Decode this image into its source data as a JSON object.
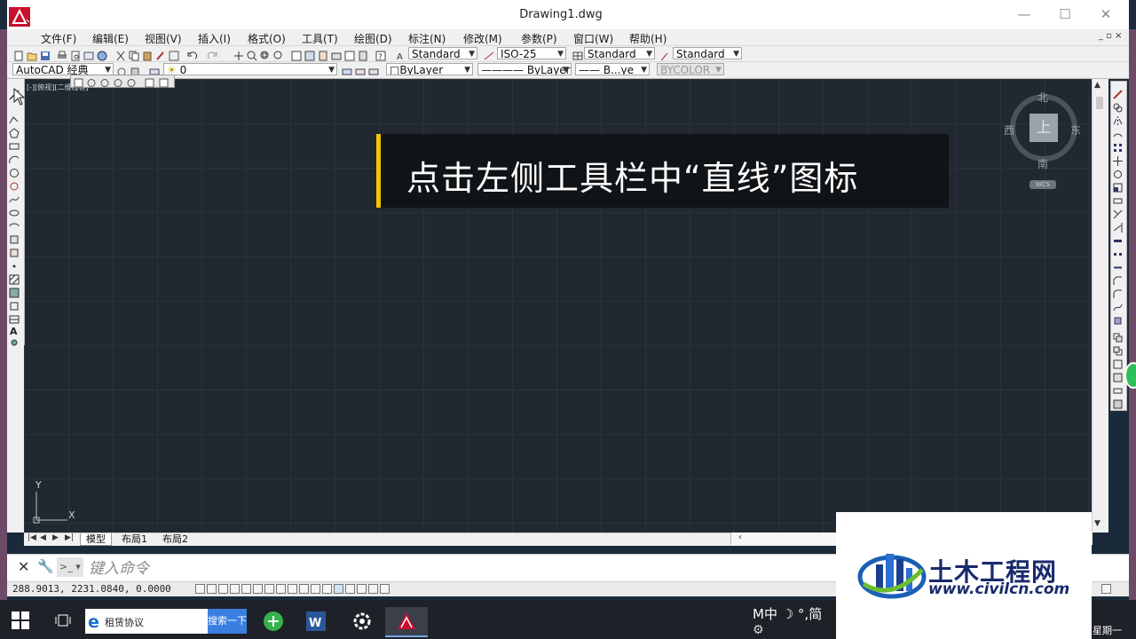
{
  "window": {
    "title": "Drawing1.dwg",
    "minimize": "—",
    "maximize": "☐",
    "close": "✕"
  },
  "menu": {
    "items": [
      "文件(F)",
      "编辑(E)",
      "视图(V)",
      "插入(I)",
      "格式(O)",
      "工具(T)",
      "绘图(D)",
      "标注(N)",
      "修改(M)",
      "参数(P)",
      "窗口(W)",
      "帮助(H)"
    ],
    "mdi_controls": "_ ▫ ×"
  },
  "toolbar1": {
    "text_style": "Standard",
    "dim_style": "ISO-25",
    "table_style": "Standard",
    "multileader_style": "Standard"
  },
  "toolbar2": {
    "workspace": "AutoCAD 经典",
    "layer": "0",
    "color": "ByLayer",
    "linetype": "ByLayer",
    "lineweight": "B...ye",
    "plotstyle": "BYCOLOR"
  },
  "viewport": {
    "label": "[-][俯视][二维线框]"
  },
  "viewcube": {
    "north": "北",
    "south": "南",
    "east": "东",
    "west": "西",
    "face": "上",
    "wcs": "WCS"
  },
  "caption": {
    "text": "点击左侧工具栏中“直线”图标",
    "accent_color": "#f5c400"
  },
  "ucs": {
    "x_label": "X",
    "y_label": "Y"
  },
  "tabs": {
    "items": [
      "模型",
      "布局1",
      "布局2"
    ]
  },
  "command": {
    "placeholder": "键入命令",
    "prompt_icon": ">_ ▾"
  },
  "status": {
    "coordinates": "288.9013,  2231.0840,  0.0000"
  },
  "taskbar": {
    "search_text": "租赁协议",
    "search_button": "搜索一下",
    "ime": "M中 ☽ °,简",
    "weekday": "星期一"
  },
  "watermark": {
    "title": "土木工程网",
    "url": "www.civilcn.com"
  }
}
